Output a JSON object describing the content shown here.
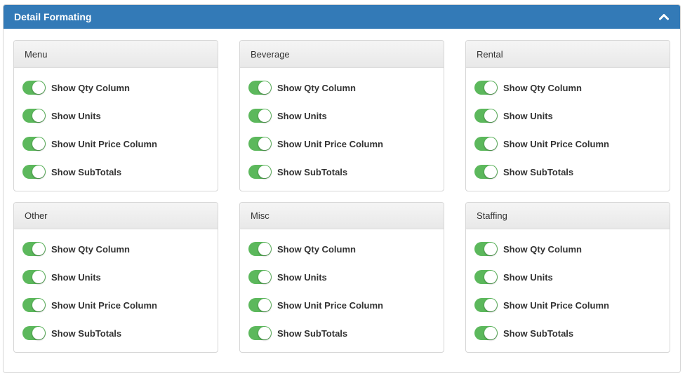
{
  "panel": {
    "title": "Detail Formating",
    "collapse_icon": "chevron-up-icon",
    "header_color": "#337ab7"
  },
  "toggle_on_color": "#5cb85c",
  "sections": [
    {
      "title": "Menu",
      "toggles": [
        {
          "label": "Show Qty Column",
          "on": true
        },
        {
          "label": "Show Units",
          "on": true
        },
        {
          "label": "Show Unit Price Column",
          "on": true
        },
        {
          "label": "Show SubTotals",
          "on": true
        }
      ]
    },
    {
      "title": "Beverage",
      "toggles": [
        {
          "label": "Show Qty Column",
          "on": true
        },
        {
          "label": "Show Units",
          "on": true
        },
        {
          "label": "Show Unit Price Column",
          "on": true
        },
        {
          "label": "Show SubTotals",
          "on": true
        }
      ]
    },
    {
      "title": "Rental",
      "toggles": [
        {
          "label": "Show Qty Column",
          "on": true
        },
        {
          "label": "Show Units",
          "on": true
        },
        {
          "label": "Show Unit Price Column",
          "on": true
        },
        {
          "label": "Show SubTotals",
          "on": true
        }
      ]
    },
    {
      "title": "Other",
      "toggles": [
        {
          "label": "Show Qty Column",
          "on": true
        },
        {
          "label": "Show Units",
          "on": true
        },
        {
          "label": "Show Unit Price Column",
          "on": true
        },
        {
          "label": "Show SubTotals",
          "on": true
        }
      ]
    },
    {
      "title": "Misc",
      "toggles": [
        {
          "label": "Show Qty Column",
          "on": true
        },
        {
          "label": "Show Units",
          "on": true
        },
        {
          "label": "Show Unit Price Column",
          "on": true
        },
        {
          "label": "Show SubTotals",
          "on": true
        }
      ]
    },
    {
      "title": "Staffing",
      "toggles": [
        {
          "label": "Show Qty Column",
          "on": true
        },
        {
          "label": "Show Units",
          "on": true
        },
        {
          "label": "Show Unit Price Column",
          "on": true
        },
        {
          "label": "Show SubTotals",
          "on": true
        }
      ]
    }
  ]
}
